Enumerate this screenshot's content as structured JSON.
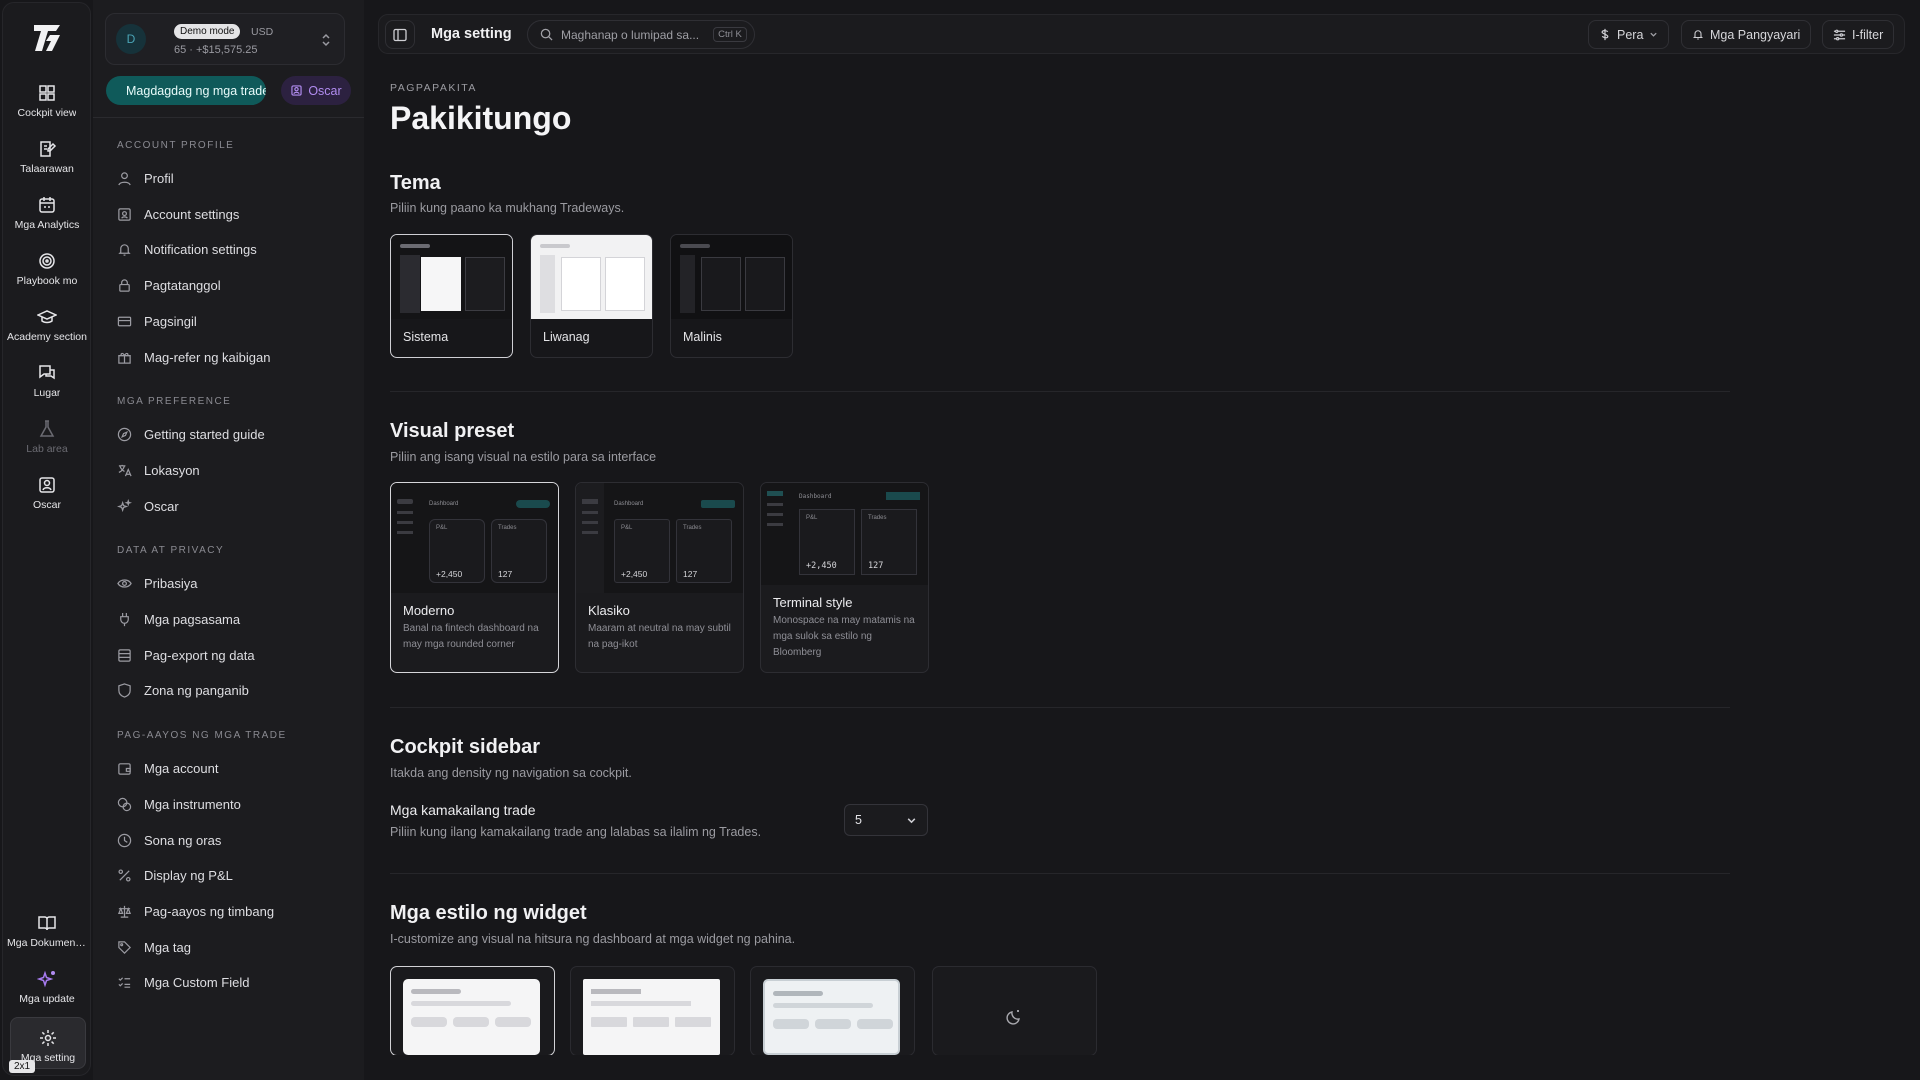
{
  "rail": {
    "items": [
      {
        "label": "Cockpit view",
        "icon": "grid-icon"
      },
      {
        "label": "Talaarawan",
        "icon": "journal-edit-icon"
      },
      {
        "label": "Mga Analytics",
        "icon": "calendar-icon"
      },
      {
        "label": "Playbook mo",
        "icon": "target-icon"
      },
      {
        "label": "Academy section",
        "icon": "graduation-cap-icon"
      },
      {
        "label": "Lugar",
        "icon": "chat-icon"
      },
      {
        "label": "Lab area",
        "icon": "flask-icon"
      },
      {
        "label": "Oscar",
        "icon": "assistant-icon"
      }
    ],
    "bottom": [
      {
        "label": "Mga Dokumentasyon",
        "icon": "book-icon"
      },
      {
        "label": "Mga update",
        "icon": "sparkle-icon"
      },
      {
        "label": "Mga setting",
        "icon": "gear-icon"
      }
    ],
    "badge": "2x1"
  },
  "account": {
    "avatar": "D",
    "mode": "Demo mode",
    "currency": "USD",
    "balance": "65 · +$15,575.25"
  },
  "actions": {
    "add_label": "Magdagdag ng mga trade",
    "oscar_label": "Oscar"
  },
  "sections": [
    {
      "title": "ACCOUNT PROFILE",
      "items": [
        {
          "label": "Profil",
          "icon": "user-icon"
        },
        {
          "label": "Account settings",
          "icon": "id-card-icon"
        },
        {
          "label": "Notification settings",
          "icon": "bell-icon"
        },
        {
          "label": "Pagtatanggol",
          "icon": "lock-icon"
        },
        {
          "label": "Pagsingil",
          "icon": "credit-card-icon"
        },
        {
          "label": "Mag-refer ng kaibigan",
          "icon": "gift-icon"
        }
      ]
    },
    {
      "title": "MGA PREFERENCE",
      "items": [
        {
          "label": "Getting started guide",
          "icon": "compass-icon"
        },
        {
          "label": "Lokasyon",
          "icon": "translate-icon"
        },
        {
          "label": "Oscar",
          "icon": "sparkles-icon"
        }
      ]
    },
    {
      "title": "DATA AT PRIVACY",
      "items": [
        {
          "label": "Pribasiya",
          "icon": "eye-icon"
        },
        {
          "label": "Mga pagsasama",
          "icon": "plug-icon"
        },
        {
          "label": "Pag-export ng data",
          "icon": "database-icon"
        },
        {
          "label": "Zona ng panganib",
          "icon": "shield-icon"
        }
      ]
    },
    {
      "title": "PAG-AAYOS NG MGA TRADE",
      "items": [
        {
          "label": "Mga account",
          "icon": "wallet-icon"
        },
        {
          "label": "Mga instrumento",
          "icon": "coins-icon"
        },
        {
          "label": "Sona ng oras",
          "icon": "clock-icon"
        },
        {
          "label": "Display ng P&L",
          "icon": "percent-icon"
        },
        {
          "label": "Pag-aayos ng timbang",
          "icon": "scale-icon"
        },
        {
          "label": "Mga tag",
          "icon": "tag-icon"
        },
        {
          "label": "Mga Custom Field",
          "icon": "list-check-icon"
        }
      ]
    }
  ],
  "topbar": {
    "title": "Mga setting",
    "search_placeholder": "Maghanap o lumipad sa...",
    "shortcut": "Ctrl K",
    "currency_btn": "Pera",
    "events_btn": "Mga Pangyayari",
    "filter_btn": "I-filter"
  },
  "page": {
    "eyebrow": "PAGPAPAKITA",
    "title": "Pakikitungo"
  },
  "theme": {
    "title": "Tema",
    "desc": "Piliin kung paano ka mukhang Tradeways.",
    "options": [
      {
        "label": "Sistema"
      },
      {
        "label": "Liwanag"
      },
      {
        "label": "Malinis"
      }
    ],
    "selected": "Sistema"
  },
  "preset": {
    "title": "Visual preset",
    "desc": "Piliin ang isang visual na estilo para sa interface",
    "mini": {
      "dashboard": "Dashboard",
      "pnl": "P&L",
      "trades": "Trades",
      "pnl_value": "+2,450",
      "trades_value": "127"
    },
    "options": [
      {
        "title": "Moderno",
        "desc": "Banal na fintech dashboard na may mga rounded corner"
      },
      {
        "title": "Klasiko",
        "desc": "Maaram at neutral na may subtil na pag-ikot"
      },
      {
        "title": "Terminal style",
        "desc": "Monospace na may matamis na mga sulok sa estilo ng Bloomberg"
      }
    ]
  },
  "sidebar_section": {
    "title": "Cockpit sidebar",
    "desc": "Itakda ang density ng navigation sa cockpit.",
    "field_label": "Mga kamakailang trade",
    "field_desc": "Piliin kung ilang kamakailang trade ang lalabas sa ilalim ng Trades.",
    "value": "5"
  },
  "widget": {
    "title": "Mga estilo ng widget",
    "desc": "I-customize ang visual na hitsura ng dashboard at mga widget ng pahina."
  },
  "colors": {
    "accent": "#0f5a5a",
    "oscar": "#b18cf0",
    "bg": "#17171a"
  }
}
